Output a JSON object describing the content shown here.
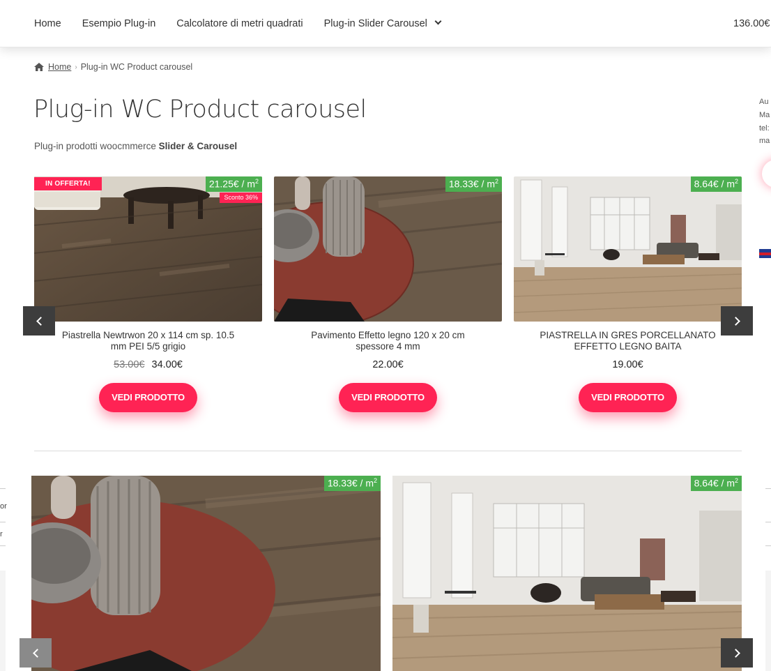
{
  "nav": {
    "items": [
      "Home",
      "Esempio Plug-in",
      "Calcolatore di metri quadrati",
      "Plug-in Slider Carousel"
    ],
    "cart_total": "136.00€"
  },
  "breadcrumb": {
    "home": "Home",
    "current": "Plug-in WC Product carousel"
  },
  "page": {
    "title": "Plug-in WC Product carousel",
    "subtitle_prefix": "Plug-in prodotti woocmmerce ",
    "subtitle_bold": "Slider & Carousel"
  },
  "sidebar": {
    "lines": [
      "Au",
      "Ma",
      "tel:",
      "ma"
    ]
  },
  "left_fragments": [
    "or",
    "r"
  ],
  "products": [
    {
      "title": "Piastrella Newtrwon 20 x 114 cm sp. 10.5 mm PEI 5/5 grigio",
      "unit_price": "21.25€ / m",
      "unit_sup": "2",
      "offer": "IN OFFERTA!",
      "discount": "Sconto 36%",
      "old_price": "53.00€",
      "price": "34.00€",
      "button": "VEDI PRODOTTO"
    },
    {
      "title": "Pavimento Effetto legno 120 x 20 cm spessore 4 mm",
      "unit_price": "18.33€ / m",
      "unit_sup": "2",
      "price": "22.00€",
      "button": "VEDI PRODOTTO"
    },
    {
      "title": "PIASTRELLA IN GRES PORCELLANATO EFFETTO LEGNO BAITA",
      "unit_price": "8.64€ / m",
      "unit_sup": "2",
      "price": "19.00€",
      "button": "VEDI PRODOTTO"
    }
  ],
  "slider2": [
    {
      "unit_price": "18.33€ / m",
      "unit_sup": "2"
    },
    {
      "unit_price": "8.64€ / m",
      "unit_sup": "2"
    }
  ],
  "colors": {
    "accent": "#ff2354",
    "badge_green": "#4caf50",
    "arrow_bg": "#3d3d3d"
  }
}
